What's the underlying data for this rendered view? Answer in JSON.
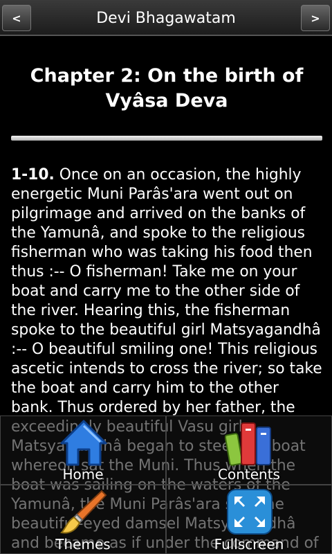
{
  "app": {
    "title": "Devi Bhagawatam"
  },
  "nav": {
    "prev_label": "<",
    "next_label": ">"
  },
  "chapter": {
    "title": "Chapter 2: On the birth of Vyâsa Deva",
    "verse_number": "1-10.",
    "text": " Once on an occasion, the highly energetic Muni Parâs'ara went out on pilgrimage and arrived on the banks of the Yamunâ, and spoke to the religious fisherman who was taking his food then thus :-- O fisherman! Take me on your boat and carry me to the other side of the river. Hearing this, the fisherman spoke to the beautiful girl Matsyagandhâ :-- O beautiful smiling one! This religious ascetic intends to cross the river; so take the boat and carry him to the other bank. Thus ordered by her father, the exceedingly beautiful Vasu girl Matsyagandhâ began to steer the boat whereon sat the Muni. Thus when the boat was sailing on the waters of the Yamunâ, the Muni Parâs'ara saw the beautiful-eyed damsel Matsyagandhâ and became as if under the command of"
  },
  "menu": {
    "home_label": "Home",
    "contents_label": "Contents",
    "themes_label": "Themes",
    "fullscreen_label": "Fullscreen"
  },
  "colors": {
    "background": "#000000",
    "home_icon": "#2f7de1",
    "fullscreen_icon": "#2a8fd8"
  }
}
